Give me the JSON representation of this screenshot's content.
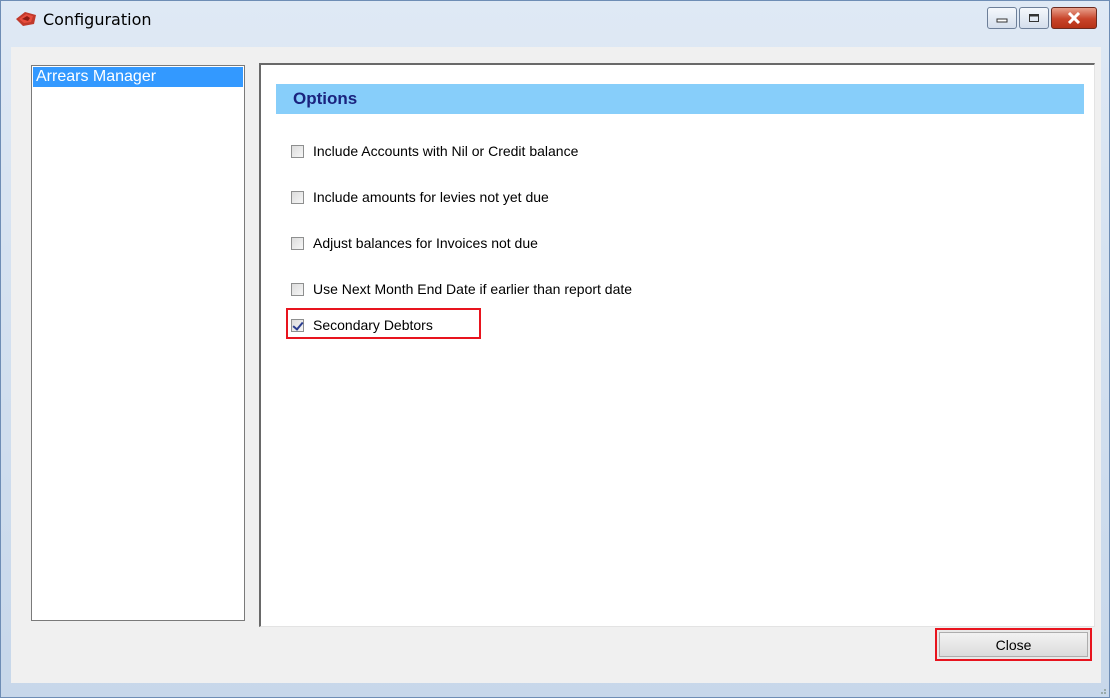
{
  "window": {
    "title": "Configuration",
    "icon": "app-red-icon"
  },
  "window_controls": {
    "minimize": "minimize-icon",
    "maximize": "maximize-icon",
    "close": "close-icon"
  },
  "sidebar": {
    "items": [
      {
        "label": "Arrears Manager",
        "selected": true
      }
    ]
  },
  "options": {
    "header": "Options",
    "items": [
      {
        "label": "Include Accounts with Nil or Credit balance",
        "checked": false
      },
      {
        "label": "Include amounts for levies not yet due",
        "checked": false
      },
      {
        "label": "Adjust balances for Invoices not due",
        "checked": false
      },
      {
        "label": "Use Next Month End Date if earlier than report date",
        "checked": false
      },
      {
        "label": "Secondary Debtors",
        "checked": true
      }
    ]
  },
  "footer": {
    "close_label": "Close"
  },
  "colors": {
    "selection": "#3399ff",
    "header_bg": "#87cefa",
    "header_text": "#1a237e",
    "highlight": "#e8141e"
  }
}
